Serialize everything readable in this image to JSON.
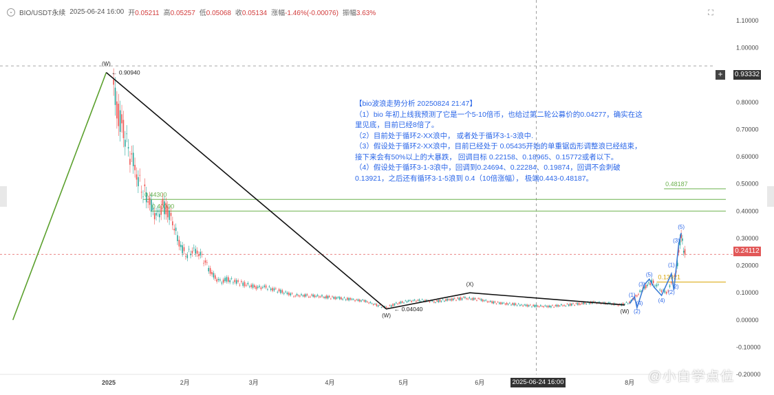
{
  "header": {
    "symbol": "BIO/USDT永续",
    "datetime": "2025-06-24 16:00",
    "open_label": "开",
    "open": "0.05211",
    "high_label": "高",
    "high": "0.05257",
    "low_label": "低",
    "low": "0.05068",
    "close_label": "收",
    "close": "0.05134",
    "change_label": "涨幅",
    "change": "-1.46%(-0.00076)",
    "amplitude_label": "振幅",
    "amplitude": "3.63%"
  },
  "analysis": {
    "lines": [
      "【bio波浪走势分析 20250824 21:47】",
      "（1）bio 年初上线我预测了它是一个5-10倍币，也给过第二轮公募价的0.04277，确实在这里见底，目前已经8倍了。",
      "（2）目前处于循环2-XX浪中， 或者处于循环3-1-3浪中.",
      "（3）假设处于循环2-XX浪中，目前已经处于 0.05435开始的单重锯齿形调整浪已经结束，接下来会有50%以上的大暴跌， 回调目标 0.22158、0.18965、0.15772或者以下。",
      "（4）假设处于循环3-1-3浪中，回调到0.24694、0.22284、0.19874，回调不会刺破0.13921，之后还有循环3-1-5浪到 0.4（10倍涨幅）， 极端0.443-0.48187。"
    ]
  },
  "price_tags": {
    "crosshair": "0.93332",
    "current": "0.24112"
  },
  "time_tag": "2025-06-24 16:00",
  "watermark": "@小白学点位",
  "chart_data": {
    "type": "candlestick",
    "yaxis": {
      "ticks": [
        "1.10000",
        "1.00000",
        "0.90000",
        "0.80000",
        "0.70000",
        "0.60000",
        "0.50000",
        "0.40000",
        "0.30000",
        "0.20000",
        "0.10000",
        "0.00000",
        "-0.10000",
        "-0.20000"
      ],
      "tick_values": [
        1.1,
        1.0,
        0.9,
        0.8,
        0.7,
        0.6,
        0.5,
        0.4,
        0.3,
        0.2,
        0.1,
        0.0,
        -0.1,
        -0.2
      ],
      "range": [
        -0.2,
        1.1
      ]
    },
    "xaxis": {
      "labels": [
        "2025",
        "2月",
        "3月",
        "4月",
        "5月",
        "6月",
        "8月"
      ],
      "label_dates": [
        "2025-01-01",
        "2025-02-01",
        "2025-03-01",
        "2025-04-01",
        "2025-05-01",
        "2025-06-01",
        "2025-08-01"
      ],
      "range": [
        "2024-11-20",
        "2025-09-10"
      ]
    },
    "price_path": [
      [
        "2025-01-03",
        0.85
      ],
      [
        "2025-01-05",
        0.75
      ],
      [
        "2025-01-07",
        0.7
      ],
      [
        "2025-01-09",
        0.62
      ],
      [
        "2025-01-11",
        0.58
      ],
      [
        "2025-01-13",
        0.52
      ],
      [
        "2025-01-15",
        0.48
      ],
      [
        "2025-01-17",
        0.45
      ],
      [
        "2025-01-19",
        0.4
      ],
      [
        "2025-01-21",
        0.38
      ],
      [
        "2025-01-23",
        0.42
      ],
      [
        "2025-01-25",
        0.4
      ],
      [
        "2025-01-27",
        0.36
      ],
      [
        "2025-01-29",
        0.3
      ],
      [
        "2025-01-31",
        0.26
      ],
      [
        "2025-02-02",
        0.24
      ],
      [
        "2025-02-04",
        0.26
      ],
      [
        "2025-02-06",
        0.25
      ],
      [
        "2025-02-08",
        0.23
      ],
      [
        "2025-02-10",
        0.2
      ],
      [
        "2025-02-12",
        0.17
      ],
      [
        "2025-02-14",
        0.15
      ],
      [
        "2025-02-16",
        0.14
      ],
      [
        "2025-02-18",
        0.15
      ],
      [
        "2025-02-22",
        0.14
      ],
      [
        "2025-02-26",
        0.13
      ],
      [
        "2025-03-02",
        0.12
      ],
      [
        "2025-03-06",
        0.12
      ],
      [
        "2025-03-10",
        0.11
      ],
      [
        "2025-03-14",
        0.1
      ],
      [
        "2025-03-18",
        0.09
      ],
      [
        "2025-03-24",
        0.09
      ],
      [
        "2025-03-30",
        0.085
      ],
      [
        "2025-04-05",
        0.08
      ],
      [
        "2025-04-10",
        0.075
      ],
      [
        "2025-04-15",
        0.07
      ],
      [
        "2025-04-20",
        0.055
      ],
      [
        "2025-04-24",
        0.045
      ],
      [
        "2025-04-28",
        0.06
      ],
      [
        "2025-05-03",
        0.07
      ],
      [
        "2025-05-08",
        0.072
      ],
      [
        "2025-05-14",
        0.068
      ],
      [
        "2025-05-20",
        0.075
      ],
      [
        "2025-05-26",
        0.08
      ],
      [
        "2025-06-01",
        0.075
      ],
      [
        "2025-06-06",
        0.065
      ],
      [
        "2025-06-12",
        0.06
      ],
      [
        "2025-06-18",
        0.055
      ],
      [
        "2025-06-24",
        0.051
      ],
      [
        "2025-06-30",
        0.05
      ],
      [
        "2025-07-06",
        0.055
      ],
      [
        "2025-07-12",
        0.06
      ],
      [
        "2025-07-18",
        0.065
      ],
      [
        "2025-07-24",
        0.06
      ],
      [
        "2025-07-28",
        0.055
      ],
      [
        "2025-08-01",
        0.065
      ],
      [
        "2025-08-04",
        0.09
      ],
      [
        "2025-08-07",
        0.12
      ],
      [
        "2025-08-10",
        0.14
      ],
      [
        "2025-08-12",
        0.13
      ],
      [
        "2025-08-14",
        0.11
      ],
      [
        "2025-08-16",
        0.1
      ],
      [
        "2025-08-18",
        0.13
      ],
      [
        "2025-08-20",
        0.17
      ],
      [
        "2025-08-21",
        0.25
      ],
      [
        "2025-08-22",
        0.32
      ],
      [
        "2025-08-23",
        0.26
      ],
      [
        "2025-08-24",
        0.24
      ]
    ],
    "wave_lines": [
      {
        "color": "#5aa02c",
        "points": [
          [
            "2024-11-23",
            0.0
          ],
          [
            "2024-12-31",
            0.9094
          ]
        ]
      },
      {
        "color": "#111111",
        "points": [
          [
            "2024-12-31",
            0.9094
          ],
          [
            "2025-04-24",
            0.0404
          ],
          [
            "2025-05-28",
            0.1
          ],
          [
            "2025-07-30",
            0.055
          ]
        ]
      }
    ],
    "wave_labels": [
      {
        "text": "(W)",
        "x": "2024-12-31",
        "y": 0.935,
        "color": "#222"
      },
      {
        "text": "(W)",
        "x": "2025-04-24",
        "y": 0.01,
        "color": "#222"
      },
      {
        "text": "(X)",
        "x": "2025-05-28",
        "y": 0.125,
        "color": "#222"
      },
      {
        "text": "(W)",
        "x": "2025-07-30",
        "y": 0.025,
        "color": "#222"
      },
      {
        "text": "(1)",
        "x": "2025-08-02",
        "y": 0.085,
        "color": "#2a66e8"
      },
      {
        "text": "(2)",
        "x": "2025-08-04",
        "y": 0.025,
        "color": "#2a66e8"
      },
      {
        "text": "(3)",
        "x": "2025-08-06",
        "y": 0.125,
        "color": "#2a66e8"
      },
      {
        "text": "(4)",
        "x": "2025-08-05",
        "y": 0.055,
        "color": "#2a66e8"
      },
      {
        "text": "(4)",
        "x": "2025-08-14",
        "y": 0.065,
        "color": "#2a66e8"
      },
      {
        "text": "(5)",
        "x": "2025-08-09",
        "y": 0.16,
        "color": "#2a66e8"
      },
      {
        "text": "(1)",
        "x": "2025-08-18",
        "y": 0.195,
        "color": "#2a66e8"
      },
      {
        "text": "(2)",
        "x": "2025-08-18",
        "y": 0.095,
        "color": "#2a66e8"
      },
      {
        "text": "2)",
        "x": "2025-08-20",
        "y": 0.115,
        "color": "#2a66e8"
      },
      {
        "text": "(3)",
        "x": "2025-08-20",
        "y": 0.285,
        "color": "#2a66e8"
      },
      {
        "text": "(5)",
        "x": "2025-08-22",
        "y": 0.335,
        "color": "#2a66e8"
      }
    ],
    "blue_wave_path": [
      [
        "2025-08-01",
        0.06
      ],
      [
        "2025-08-03",
        0.085
      ],
      [
        "2025-08-04",
        0.045
      ],
      [
        "2025-08-07",
        0.13
      ],
      [
        "2025-08-09",
        0.15
      ],
      [
        "2025-08-11",
        0.12
      ],
      [
        "2025-08-14",
        0.09
      ],
      [
        "2025-08-16",
        0.13
      ],
      [
        "2025-08-18",
        0.17
      ],
      [
        "2025-08-19",
        0.11
      ],
      [
        "2025-08-21",
        0.28
      ],
      [
        "2025-08-22",
        0.32
      ]
    ],
    "levels": [
      {
        "value": 0.443,
        "label": "0.44300",
        "x_start": "2025-01-15",
        "color": "#6ab04c"
      },
      {
        "value": 0.4,
        "label": "0.40000",
        "x_start": "2025-01-18",
        "color": "#6ab04c"
      },
      {
        "value": 0.48187,
        "label": "0.48187",
        "x_start": "2025-08-15",
        "color": "#6ab04c"
      },
      {
        "value": 0.13921,
        "label": "0.13921",
        "x_start": "2025-08-12",
        "color": "#d9a300"
      }
    ],
    "point_labels": [
      {
        "text": "0.90940",
        "x": "2025-01-01",
        "y": 0.9094
      },
      {
        "text": "0.04040",
        "x": "2025-04-26",
        "y": 0.0404
      }
    ],
    "crosshair": {
      "x": "2025-06-24",
      "y": 0.93332
    },
    "current_price": 0.24112
  }
}
